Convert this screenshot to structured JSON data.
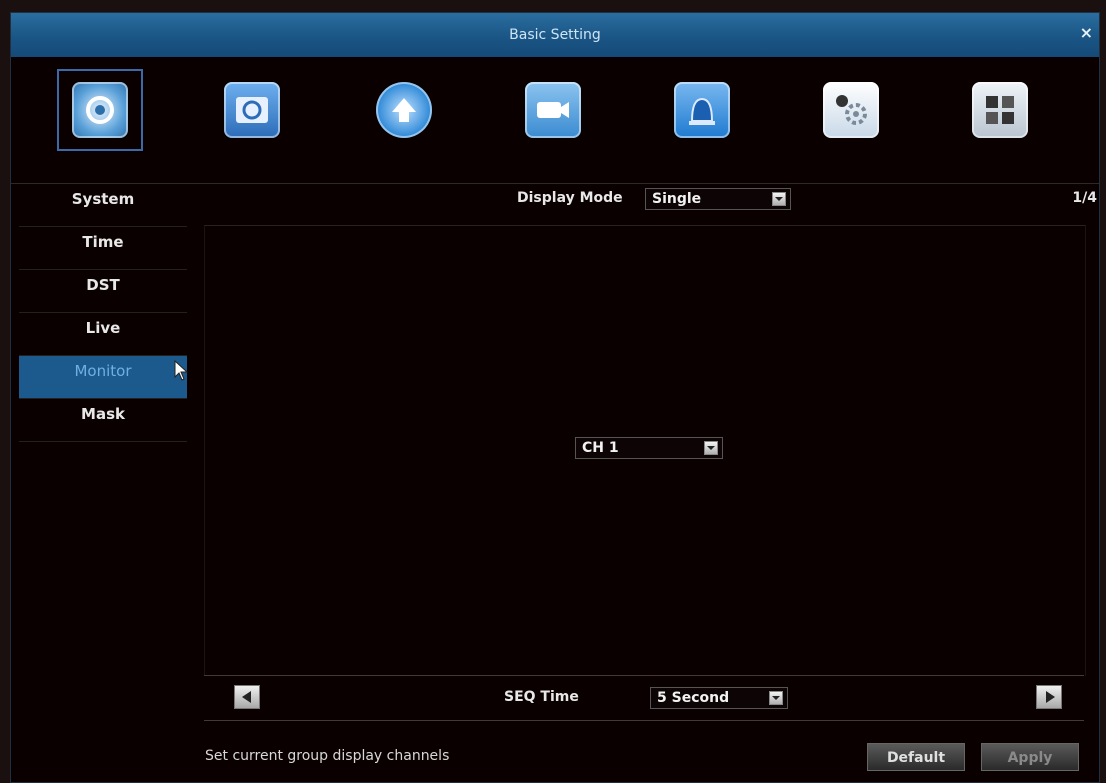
{
  "window": {
    "title": "Basic Setting",
    "close_label": "×"
  },
  "toolbar": {
    "icons": [
      {
        "name": "basic-setting-icon",
        "color": "#5aa0d8",
        "active": true
      },
      {
        "name": "record-setting-icon",
        "color": "#3b7fc8",
        "active": false
      },
      {
        "name": "network-upload-icon",
        "color": "#2a86d6",
        "active": false
      },
      {
        "name": "camera-icon",
        "color": "#3a8ad0",
        "active": false
      },
      {
        "name": "alarm-icon",
        "color": "#1e7ad0",
        "active": false
      },
      {
        "name": "advanced-settings-icon",
        "color": "#c8d8e8",
        "active": false
      },
      {
        "name": "system-info-icon",
        "color": "#b8c4d0",
        "active": false
      }
    ]
  },
  "sidebar": {
    "items": [
      {
        "label": "System"
      },
      {
        "label": "Time"
      },
      {
        "label": "DST"
      },
      {
        "label": "Live"
      },
      {
        "label": "Monitor",
        "active": true
      },
      {
        "label": "Mask"
      }
    ]
  },
  "display": {
    "mode_label": "Display Mode",
    "mode_value": "Single",
    "page_indicator": "1/4",
    "channel_value": "CH 1"
  },
  "sequence": {
    "label": "SEQ Time",
    "value": "5 Second"
  },
  "footer": {
    "hint": "Set current group display channels",
    "default_label": "Default",
    "apply_label": "Apply"
  }
}
